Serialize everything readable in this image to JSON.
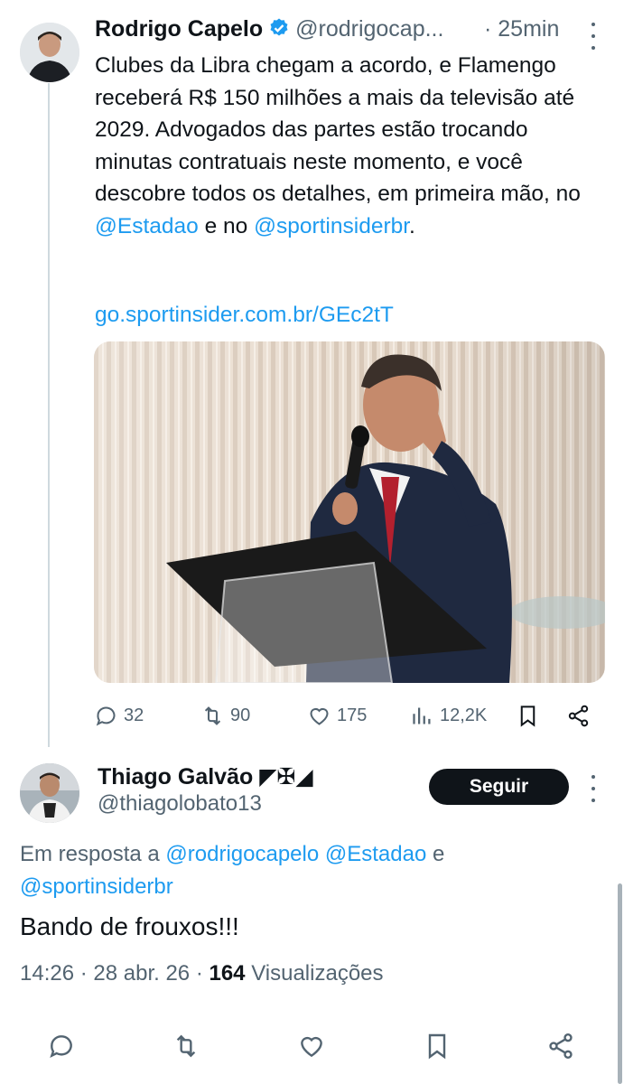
{
  "tweet": {
    "author_name": "Rodrigo Capelo",
    "handle": "@rodrigocap...",
    "time": "· 25min",
    "text_plain": "Clubes da Libra chegam a acordo, e Flamengo receberá R$ 150 milhões a mais da televisão até 2029. Advogados das partes estão trocando minutas contratuais neste momento, e você descobre todos os detalhes, em primeira mão, no ",
    "mention_1": "@Estadao",
    "text_mid": " e no ",
    "mention_2": "@sportinsiderbr",
    "text_end": ".",
    "link": "go.sportinsider.com.br/GEc2tT",
    "stats": {
      "replies": "32",
      "retweets": "90",
      "likes": "175",
      "views": "12,2K"
    }
  },
  "reply": {
    "author_name": "Thiago Galvão ◤✠◢",
    "handle": "@thiagolobato13",
    "follow_label": "Seguir",
    "in_reply_prefix": "Em resposta a ",
    "in_reply_mentions": "@rodrigocapelo @Estadao",
    "in_reply_and": " e ",
    "in_reply_mention_last": "@sportinsiderbr",
    "text": "Bando de frouxos!!!",
    "time": "14:26 · 28 abr. 26 · ",
    "views_count": "164",
    "views_label": " Visualizações"
  },
  "colors": {
    "link": "#1d9bf0",
    "muted": "#536471",
    "text": "#0f1419",
    "verified": "#1d9bf0"
  },
  "icons": [
    "verified-badge-icon",
    "reply-icon",
    "retweet-icon",
    "like-icon",
    "views-icon",
    "bookmark-icon",
    "share-icon",
    "more-icon"
  ]
}
